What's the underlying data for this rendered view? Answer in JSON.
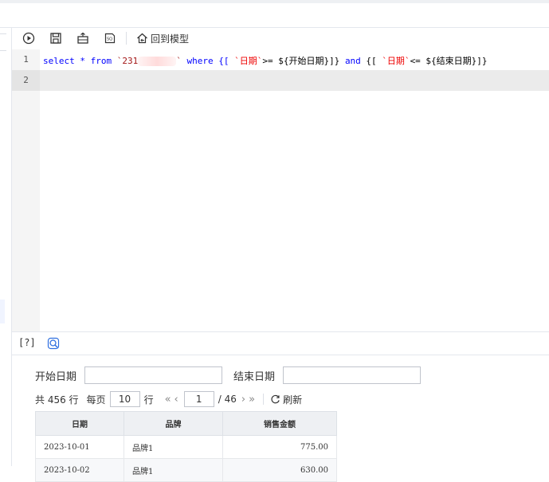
{
  "toolbar": {
    "run_icon": "play-circle-icon",
    "save_icon": "save-icon",
    "format_icon": "format-icon",
    "sql_icon": "sql-icon",
    "back_label": "回到模型"
  },
  "editor": {
    "line_numbers": [
      "1",
      "2"
    ],
    "code": {
      "p1": "select * from ",
      "table_prefix": "`231",
      "table_suffix": "`",
      "p2": " where {[ ",
      "field1": "`日期`",
      "p3": ">= ${开始日期}]} ",
      "kw_and": "and",
      "p4": " {[ ",
      "field2": "`日期`",
      "p5": "<= ${结束日期}]}"
    }
  },
  "statusbar": {
    "help": "[?]"
  },
  "params": {
    "start_label": "开始日期",
    "start_value": "",
    "end_label": "结束日期",
    "end_value": ""
  },
  "pager": {
    "total": "共 456 行",
    "per_page_label": "每页",
    "per_page_value": "10",
    "row_unit": "行",
    "first": "«",
    "prev": "‹",
    "page_value": "1",
    "page_total": "/ 46",
    "next": "›",
    "last": "»",
    "refresh": "刷新"
  },
  "table": {
    "headers": [
      "日期",
      "品牌",
      "销售金额"
    ],
    "rows": [
      [
        "2023-10-01",
        "品牌1",
        "775.00"
      ],
      [
        "2023-10-02",
        "品牌1",
        "630.00"
      ]
    ]
  }
}
